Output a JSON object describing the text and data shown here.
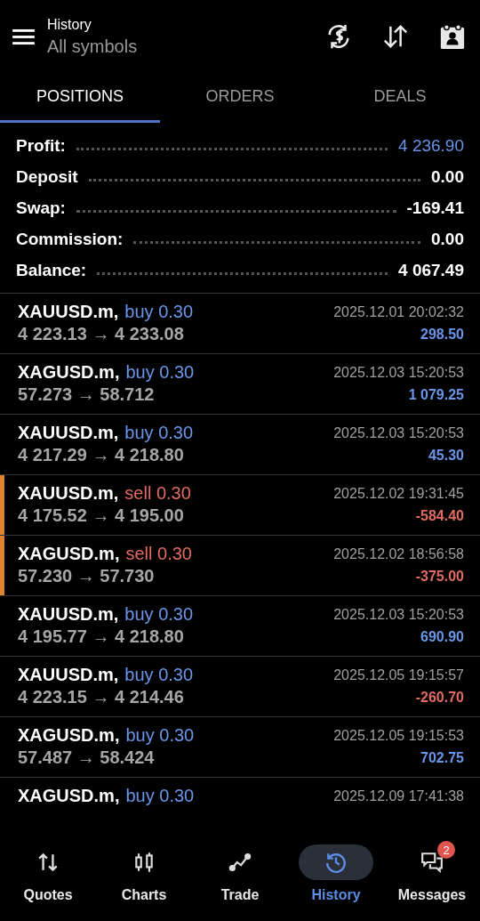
{
  "header": {
    "title": "History",
    "subtitle": "All symbols"
  },
  "tabs": [
    {
      "label": "POSITIONS",
      "selected": true
    },
    {
      "label": "ORDERS",
      "selected": false
    },
    {
      "label": "DEALS",
      "selected": false
    }
  ],
  "summary": [
    {
      "label": "Profit:",
      "value": "4 236.90",
      "highlight": true
    },
    {
      "label": "Deposit",
      "value": "0.00",
      "highlight": false
    },
    {
      "label": "Swap:",
      "value": "-169.41",
      "highlight": false
    },
    {
      "label": "Commission:",
      "value": "0.00",
      "highlight": false
    },
    {
      "label": "Balance:",
      "value": "4 067.49",
      "highlight": false
    }
  ],
  "positions": [
    {
      "symbol": "XAUUSD.m,",
      "kind": "buy",
      "side": "buy 0.30",
      "prices": "4 223.13 → 4 233.08",
      "time": "2025.12.01 20:02:32",
      "profit": "298.50",
      "loss": false
    },
    {
      "symbol": "XAGUSD.m,",
      "kind": "buy",
      "side": "buy 0.30",
      "prices": "57.273 → 58.712",
      "time": "2025.12.03 15:20:53",
      "profit": "1 079.25",
      "loss": false
    },
    {
      "symbol": "XAUUSD.m,",
      "kind": "buy",
      "side": "buy 0.30",
      "prices": "4 217.29 → 4 218.80",
      "time": "2025.12.03 15:20:53",
      "profit": "45.30",
      "loss": false
    },
    {
      "symbol": "XAUUSD.m,",
      "kind": "sell",
      "side": "sell 0.30",
      "prices": "4 175.52 → 4 195.00",
      "time": "2025.12.02 19:31:45",
      "profit": "-584.40",
      "loss": true
    },
    {
      "symbol": "XAGUSD.m,",
      "kind": "sell",
      "side": "sell 0.30",
      "prices": "57.230 → 57.730",
      "time": "2025.12.02 18:56:58",
      "profit": "-375.00",
      "loss": true
    },
    {
      "symbol": "XAUUSD.m,",
      "kind": "buy",
      "side": "buy 0.30",
      "prices": "4 195.77 → 4 218.80",
      "time": "2025.12.03 15:20:53",
      "profit": "690.90",
      "loss": false
    },
    {
      "symbol": "XAUUSD.m,",
      "kind": "buy",
      "side": "buy 0.30",
      "prices": "4 223.15 → 4 214.46",
      "time": "2025.12.05 19:15:57",
      "profit": "-260.70",
      "loss": true
    },
    {
      "symbol": "XAGUSD.m,",
      "kind": "buy",
      "side": "buy 0.30",
      "prices": "57.487 → 58.424",
      "time": "2025.12.05 19:15:53",
      "profit": "702.75",
      "loss": false
    },
    {
      "symbol": "XAGUSD.m,",
      "kind": "buy",
      "side": "buy 0.30",
      "time": "2025.12.09 17:41:38"
    }
  ],
  "nav": [
    {
      "label": "Quotes",
      "kind": "quotes",
      "selected": false
    },
    {
      "label": "Charts",
      "kind": "charts",
      "selected": false
    },
    {
      "label": "Trade",
      "kind": "trade",
      "selected": false
    },
    {
      "label": "History",
      "kind": "history",
      "selected": true
    },
    {
      "label": "Messages",
      "kind": "messages",
      "selected": false,
      "badge": "2"
    }
  ]
}
